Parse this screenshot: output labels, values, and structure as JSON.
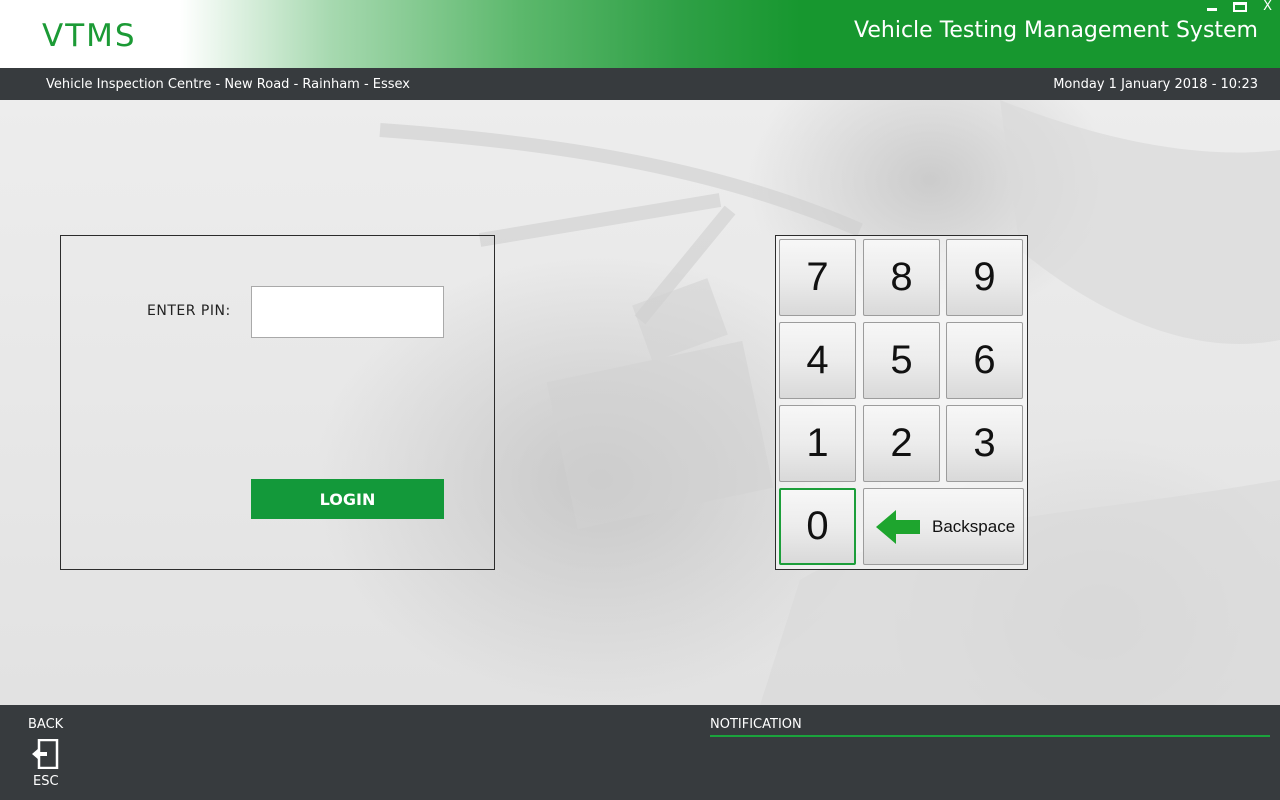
{
  "header": {
    "logo": "VTMS",
    "title": "Vehicle Testing Management System",
    "window_controls": {
      "minimize": "minimize-icon",
      "maximize": "maximize-icon",
      "close": "X"
    }
  },
  "infobar": {
    "location": "Vehicle Inspection Centre - New Road - Rainham - Essex",
    "datetime": "Monday 1 January 2018 - 10:23"
  },
  "login": {
    "pin_label": "ENTER PIN:",
    "pin_value": "",
    "button_label": "LOGIN"
  },
  "keypad": {
    "keys": [
      "7",
      "8",
      "9",
      "4",
      "5",
      "6",
      "1",
      "2",
      "3",
      "0"
    ],
    "backspace_label": "Backspace",
    "backspace_icon": "arrow-left-icon"
  },
  "footer": {
    "back_label": "BACK",
    "back_icon": "exit-door-icon",
    "esc_label": "ESC",
    "notification_label": "NOTIFICATION"
  },
  "colors": {
    "brand_green": "#17972f",
    "button_green": "#13993a",
    "bar_dark": "#373b3e"
  }
}
